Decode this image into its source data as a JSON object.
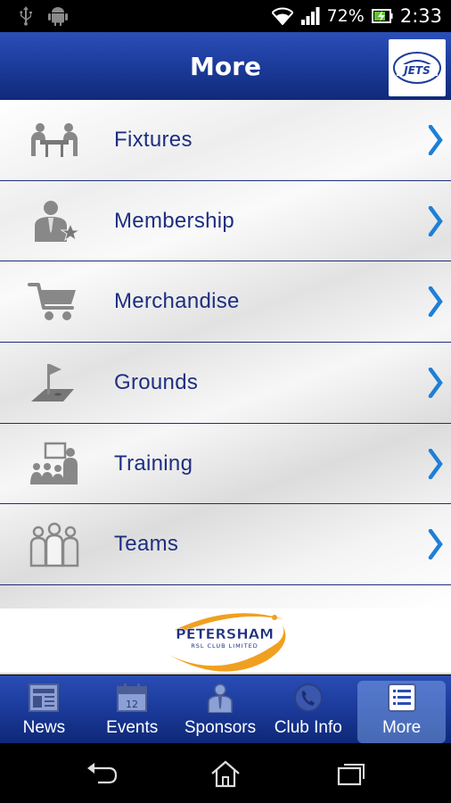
{
  "status_bar": {
    "battery_percent": "72%",
    "time": "2:33",
    "icons": [
      "usb-icon",
      "android-icon",
      "wifi-icon",
      "signal-icon",
      "battery-icon"
    ]
  },
  "header": {
    "title": "More",
    "logo_text": "JETS"
  },
  "menu": {
    "items": [
      {
        "label": "Fixtures",
        "icon": "fixtures-icon"
      },
      {
        "label": "Membership",
        "icon": "membership-icon"
      },
      {
        "label": "Merchandise",
        "icon": "cart-icon"
      },
      {
        "label": "Grounds",
        "icon": "flag-icon"
      },
      {
        "label": "Training",
        "icon": "training-icon"
      },
      {
        "label": "Teams",
        "icon": "teams-icon"
      }
    ]
  },
  "sponsor": {
    "name": "PETERSHAM",
    "subtitle": "RSL CLUB LIMITED"
  },
  "tabs": [
    {
      "label": "News",
      "icon": "news-icon"
    },
    {
      "label": "Events",
      "icon": "calendar-icon",
      "badge": "12"
    },
    {
      "label": "Sponsors",
      "icon": "person-icon"
    },
    {
      "label": "Club Info",
      "icon": "phone-icon"
    },
    {
      "label": "More",
      "icon": "list-icon",
      "active": true
    }
  ],
  "colors": {
    "header_blue": "#1d3d9e",
    "label_blue": "#1d2f80",
    "chevron_blue": "#1e7fd8",
    "accent_orange": "#f0a020"
  }
}
